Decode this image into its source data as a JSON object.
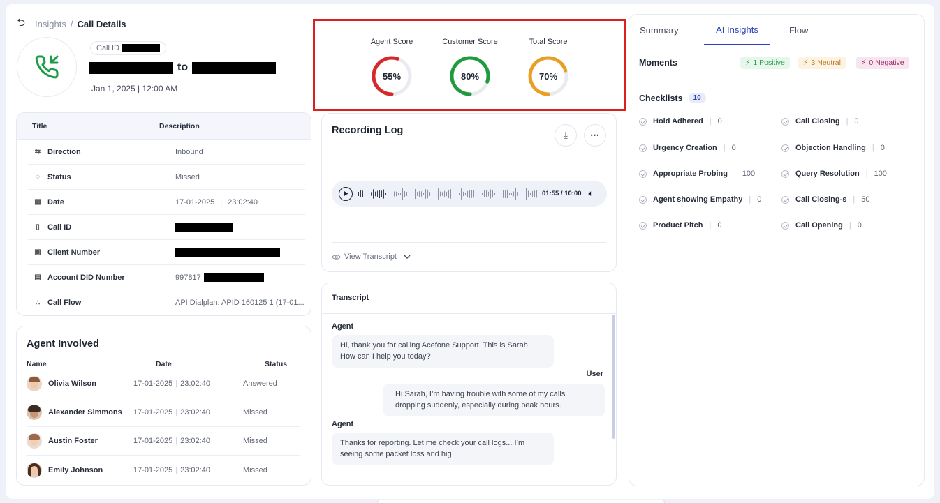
{
  "breadcrumb": {
    "parent": "Insights",
    "separator": "/",
    "current": "Call Details"
  },
  "call": {
    "id_label": "Call ID",
    "connector": "to",
    "datetime": "Jan 1, 2025 | 12:00 AM"
  },
  "details": {
    "headers": [
      "Title",
      "Description"
    ],
    "rows": [
      {
        "label": "Direction",
        "icon": "arrows-swap-icon",
        "value": "Inbound"
      },
      {
        "label": "Status",
        "icon": "status-circle-icon",
        "value": "Missed"
      },
      {
        "label": "Date",
        "icon": "calendar-icon",
        "date": "17-01-2025",
        "time": "23:02:40"
      },
      {
        "label": "Call ID",
        "icon": "document-icon",
        "value": ""
      },
      {
        "label": "Client Number",
        "icon": "contact-icon",
        "value": ""
      },
      {
        "label": "Account DID Number",
        "icon": "id-card-icon",
        "value": "997817"
      },
      {
        "label": "Call Flow",
        "icon": "flow-icon",
        "value": "API Dialplan: APID 160125 1 (17-01..."
      }
    ]
  },
  "agents": {
    "title": "Agent Involved",
    "columns": [
      "Name",
      "Date",
      "Status"
    ],
    "rows": [
      {
        "name": "Olivia Wilson",
        "date": "17-01-2025",
        "time": "23:02:40",
        "status": "Answered"
      },
      {
        "name": "Alexander Simmons",
        "date": "17-01-2025",
        "time": "23:02:40",
        "status": "Missed"
      },
      {
        "name": "Austin Foster",
        "date": "17-01-2025",
        "time": "23:02:40",
        "status": "Missed"
      },
      {
        "name": "Emily Johnson",
        "date": "17-01-2025",
        "time": "23:02:40",
        "status": "Missed"
      }
    ]
  },
  "scores": [
    {
      "label": "Agent Score",
      "value": 55,
      "text": "55%",
      "color": "#d62a2a"
    },
    {
      "label": "Customer Score",
      "value": 80,
      "text": "80%",
      "color": "#1f9a3c"
    },
    {
      "label": "Total Score",
      "value": 70,
      "text": "70%",
      "color": "#e8a024"
    }
  ],
  "recording": {
    "title": "Recording Log",
    "time": "01:55 / 10:00",
    "progress": 0.19,
    "view_transcript": "View Transcript"
  },
  "transcript": {
    "tab": "Transcript",
    "messages": [
      {
        "speaker": "Agent",
        "lines": [
          "Hi, thank you for calling Acefone Support. This is Sarah.",
          "How can I help you today?"
        ]
      },
      {
        "speaker": "User",
        "lines": [
          "Hi Sarah, I’m having trouble with some of my calls",
          "dropping suddenly, especially during peak hours."
        ]
      },
      {
        "speaker": "Agent",
        "lines": [
          "Thanks for reporting. Let me check your call logs... I’m",
          "seeing some packet loss and hig"
        ]
      }
    ]
  },
  "right_panel": {
    "tabs": [
      "Summary",
      "AI Insights",
      "Flow"
    ],
    "active_tab": "AI Insights",
    "moments": {
      "title": "Moments",
      "positive": "1 Positive",
      "neutral": "3 Neutral",
      "negative": "0 Negative"
    },
    "checklists": {
      "title": "Checklists",
      "count": "10",
      "items": [
        {
          "name": "Hold Adhered",
          "value": "0"
        },
        {
          "name": "Call Closing",
          "value": "0"
        },
        {
          "name": "Urgency Creation",
          "value": "0"
        },
        {
          "name": "Objection Handling",
          "value": "0"
        },
        {
          "name": "Appropriate Probing",
          "value": "100"
        },
        {
          "name": "Query Resolution",
          "value": "100"
        },
        {
          "name": "Agent showing Empathy",
          "value": "0"
        },
        {
          "name": "Call Closing-s",
          "value": "50"
        },
        {
          "name": "Product Pitch",
          "value": "0"
        },
        {
          "name": "Call Opening",
          "value": "0"
        }
      ]
    }
  },
  "colors": {
    "accent": "#2c43b8",
    "highlight_border": "#dc1f1f",
    "call_icon": "#1a9d46"
  }
}
